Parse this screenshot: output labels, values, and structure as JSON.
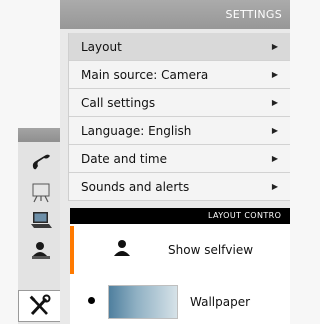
{
  "settings": {
    "title": "SETTINGS",
    "menu": [
      {
        "label": "Layout",
        "arrow": "▶"
      },
      {
        "label": "Main source: Camera",
        "arrow": "▶"
      },
      {
        "label": "Call settings",
        "arrow": "▶"
      },
      {
        "label": "Language: English",
        "arrow": "▶"
      },
      {
        "label": "Date and time",
        "arrow": "▶"
      },
      {
        "label": "Sounds and alerts",
        "arrow": "▶"
      }
    ]
  },
  "layout_control": {
    "title": "LAYOUT CONTRO",
    "selfview_label": "Show selfview",
    "wallpaper_label": "Wallpaper",
    "accent_color": "#ff7a00"
  },
  "toolbar": {
    "icons": [
      "phone-icon",
      "presentation-icon",
      "laptop-icon",
      "contacts-icon",
      "tools-icon"
    ],
    "selected": "tools-icon"
  }
}
